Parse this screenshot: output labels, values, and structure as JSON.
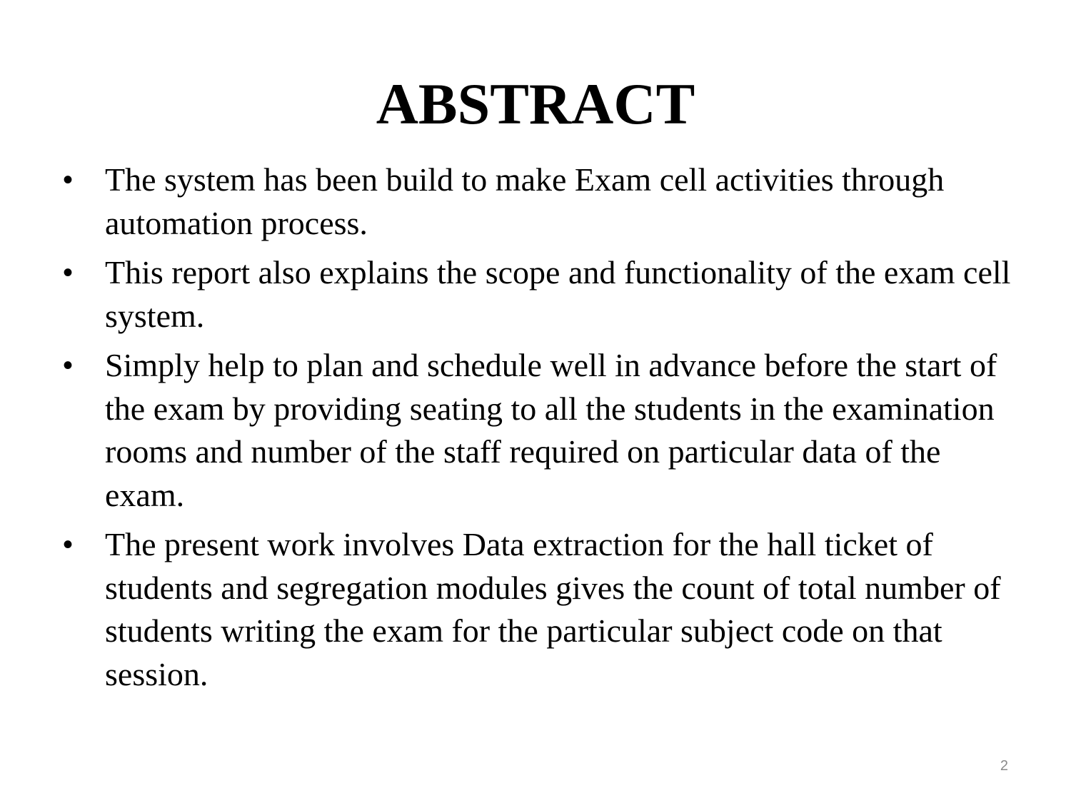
{
  "slide": {
    "title": "ABSTRACT",
    "bullets": [
      "The system has been build to make Exam cell activities through automation process.",
      "This report also explains the scope and functionality of the exam cell system.",
      "Simply help to plan and schedule well in advance before the start of the exam by providing seating to all the students in the examination rooms and number of the staff required on particular data of the exam.",
      "The present work involves Data extraction for the hall ticket of students and segregation modules gives the count of total number of students writing the exam for the particular subject code on that session."
    ],
    "bullet_glyph": "•",
    "page_number": "2",
    "colors": {
      "text": "#000000",
      "page_number": "#8a8a8a",
      "background": "#ffffff"
    }
  }
}
